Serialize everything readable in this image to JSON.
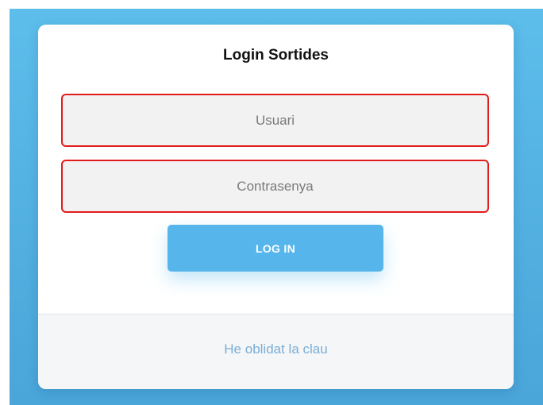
{
  "login": {
    "title": "Login Sortides",
    "username_placeholder": "Usuari",
    "username_value": "",
    "password_placeholder": "Contrasenya",
    "password_value": "",
    "login_button_label": "LOG IN",
    "forgot_link_label": "He oblidat la clau"
  },
  "colors": {
    "background_blue": "#56b8ea",
    "field_error_border": "#e21b1b",
    "button_blue": "#56b6ec",
    "link_blue": "#7aaed6"
  }
}
